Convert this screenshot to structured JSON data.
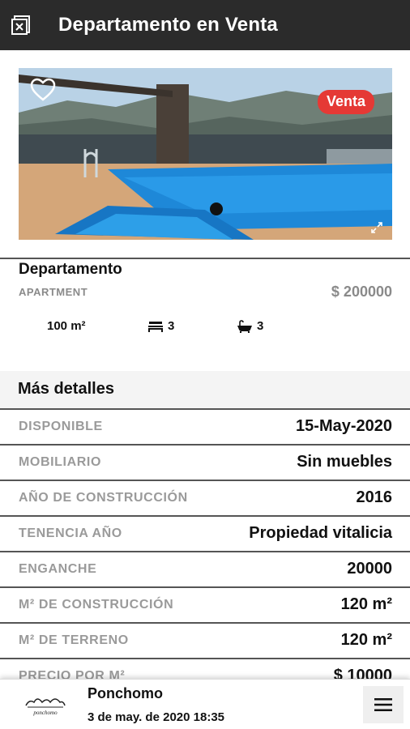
{
  "header": {
    "title": "Departamento en Venta",
    "back_icon": "close-box-icon"
  },
  "listing": {
    "badge": "Venta",
    "favorite_icon": "heart-icon",
    "type": "Departamento",
    "category": "APARTMENT",
    "price": "$ 200000",
    "features": {
      "area": "100 m²",
      "bedrooms": "3",
      "bathrooms": "3"
    }
  },
  "details": {
    "title": "Más detalles",
    "rows": [
      {
        "label": "DISPONIBLE",
        "value": "15-May-2020"
      },
      {
        "label": "MOBILIARIO",
        "value": "Sin muebles"
      },
      {
        "label": "AÑO DE CONSTRUCCIÓN",
        "value": "2016"
      },
      {
        "label": "TENENCIA AÑO",
        "value": "Propiedad vitalicia"
      },
      {
        "label": "ENGANCHE",
        "value": "20000"
      },
      {
        "label": "M² DE CONSTRUCCIÓN",
        "value": "120 m²"
      },
      {
        "label": "M² DE TERRENO",
        "value": "120 m²"
      },
      {
        "label": "PRECIO POR M²",
        "value": "$ 10000"
      }
    ]
  },
  "agent": {
    "name": "Ponchomo",
    "date": "3 de may. de 2020 18:35",
    "logo_text": "ponchomo"
  },
  "colors": {
    "topbar": "#2b2b2b",
    "badge": "#e53935",
    "muted_text": "#9a9a9a"
  }
}
